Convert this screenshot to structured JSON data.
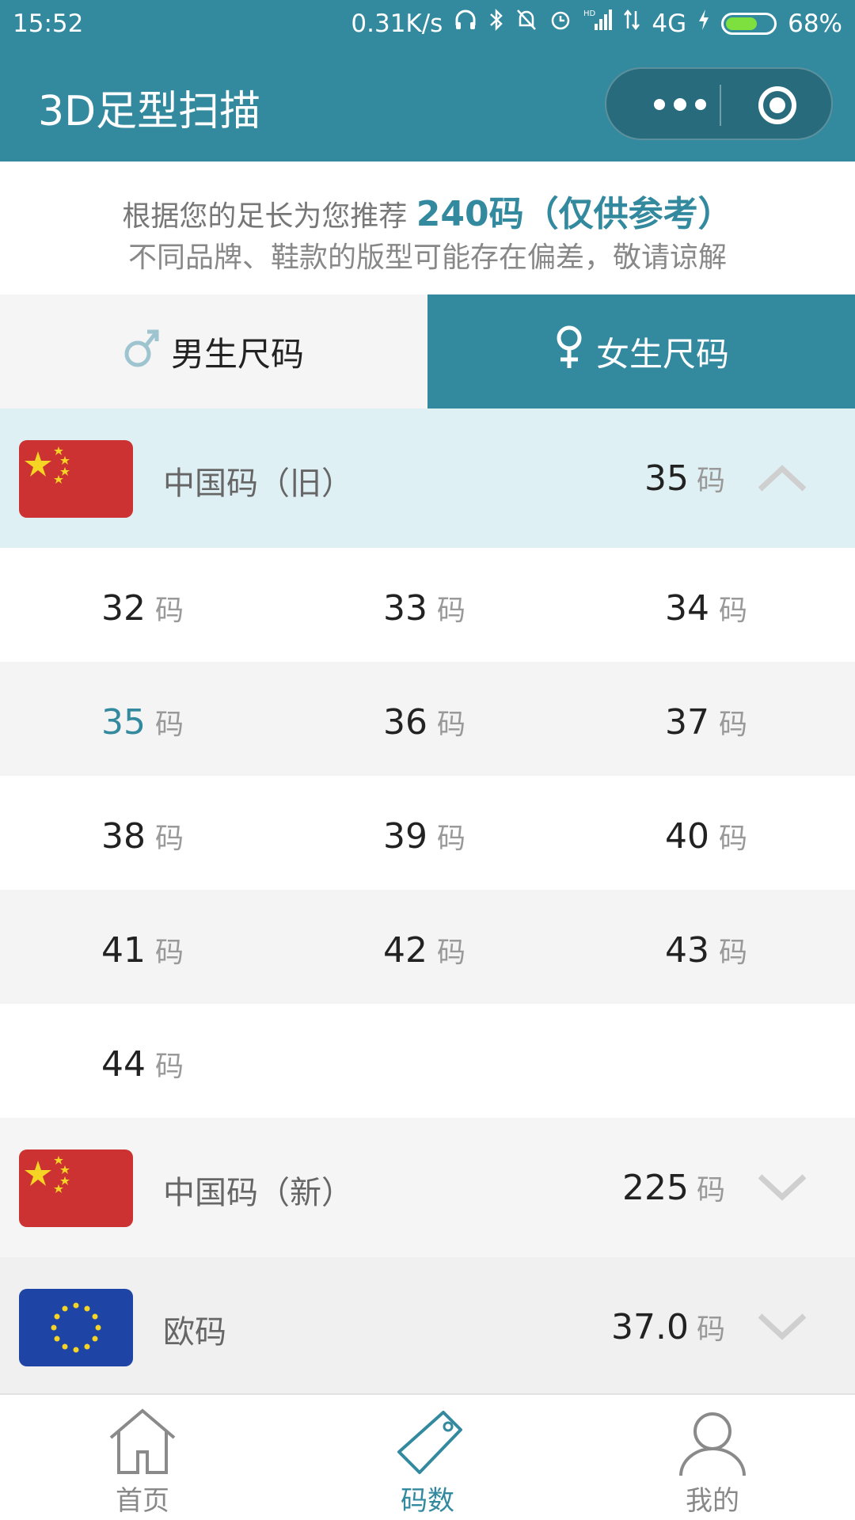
{
  "status_bar": {
    "time": "15:52",
    "net_speed": "0.31K/s",
    "network": "4G",
    "battery_percent": "68%",
    "battery_level": 0.68,
    "hd_label": "HD"
  },
  "header": {
    "title": "3D足型扫描"
  },
  "recommendation": {
    "prefix": "根据您的足长为您推荐 ",
    "size": "240码（仅供参考）",
    "note": "不同品牌、鞋款的版型可能存在偏差，敬请谅解"
  },
  "gender_tabs": [
    {
      "label": "男生尺码",
      "icon": "male-symbol-icon",
      "active": false
    },
    {
      "label": "女生尺码",
      "icon": "female-symbol-icon",
      "active": true
    }
  ],
  "regions": [
    {
      "name": "中国码（旧）",
      "value": "35",
      "unit": "码",
      "flag": "china-flag-icon",
      "expanded": true
    },
    {
      "name": "中国码（新）",
      "value": "225",
      "unit": "码",
      "flag": "china-flag-icon",
      "expanded": false
    },
    {
      "name": "欧码",
      "value": "37.0",
      "unit": "码",
      "flag": "eu-flag-icon",
      "expanded": false
    }
  ],
  "size_grid": {
    "unit": "码",
    "selected": "35",
    "rows": [
      [
        "32",
        "33",
        "34"
      ],
      [
        "35",
        "36",
        "37"
      ],
      [
        "38",
        "39",
        "40"
      ],
      [
        "41",
        "42",
        "43"
      ],
      [
        "44"
      ]
    ]
  },
  "bottom_nav": [
    {
      "label": "首页",
      "icon": "home-icon",
      "active": false
    },
    {
      "label": "码数",
      "icon": "tag-icon",
      "active": true
    },
    {
      "label": "我的",
      "icon": "user-icon",
      "active": false
    }
  ],
  "colors": {
    "accent": "#338a9f",
    "selected_region_bg": "#dff0f4",
    "china_flag_red": "#cc3232",
    "eu_flag_blue": "#1e44a6",
    "star_yellow": "#f5d424"
  }
}
